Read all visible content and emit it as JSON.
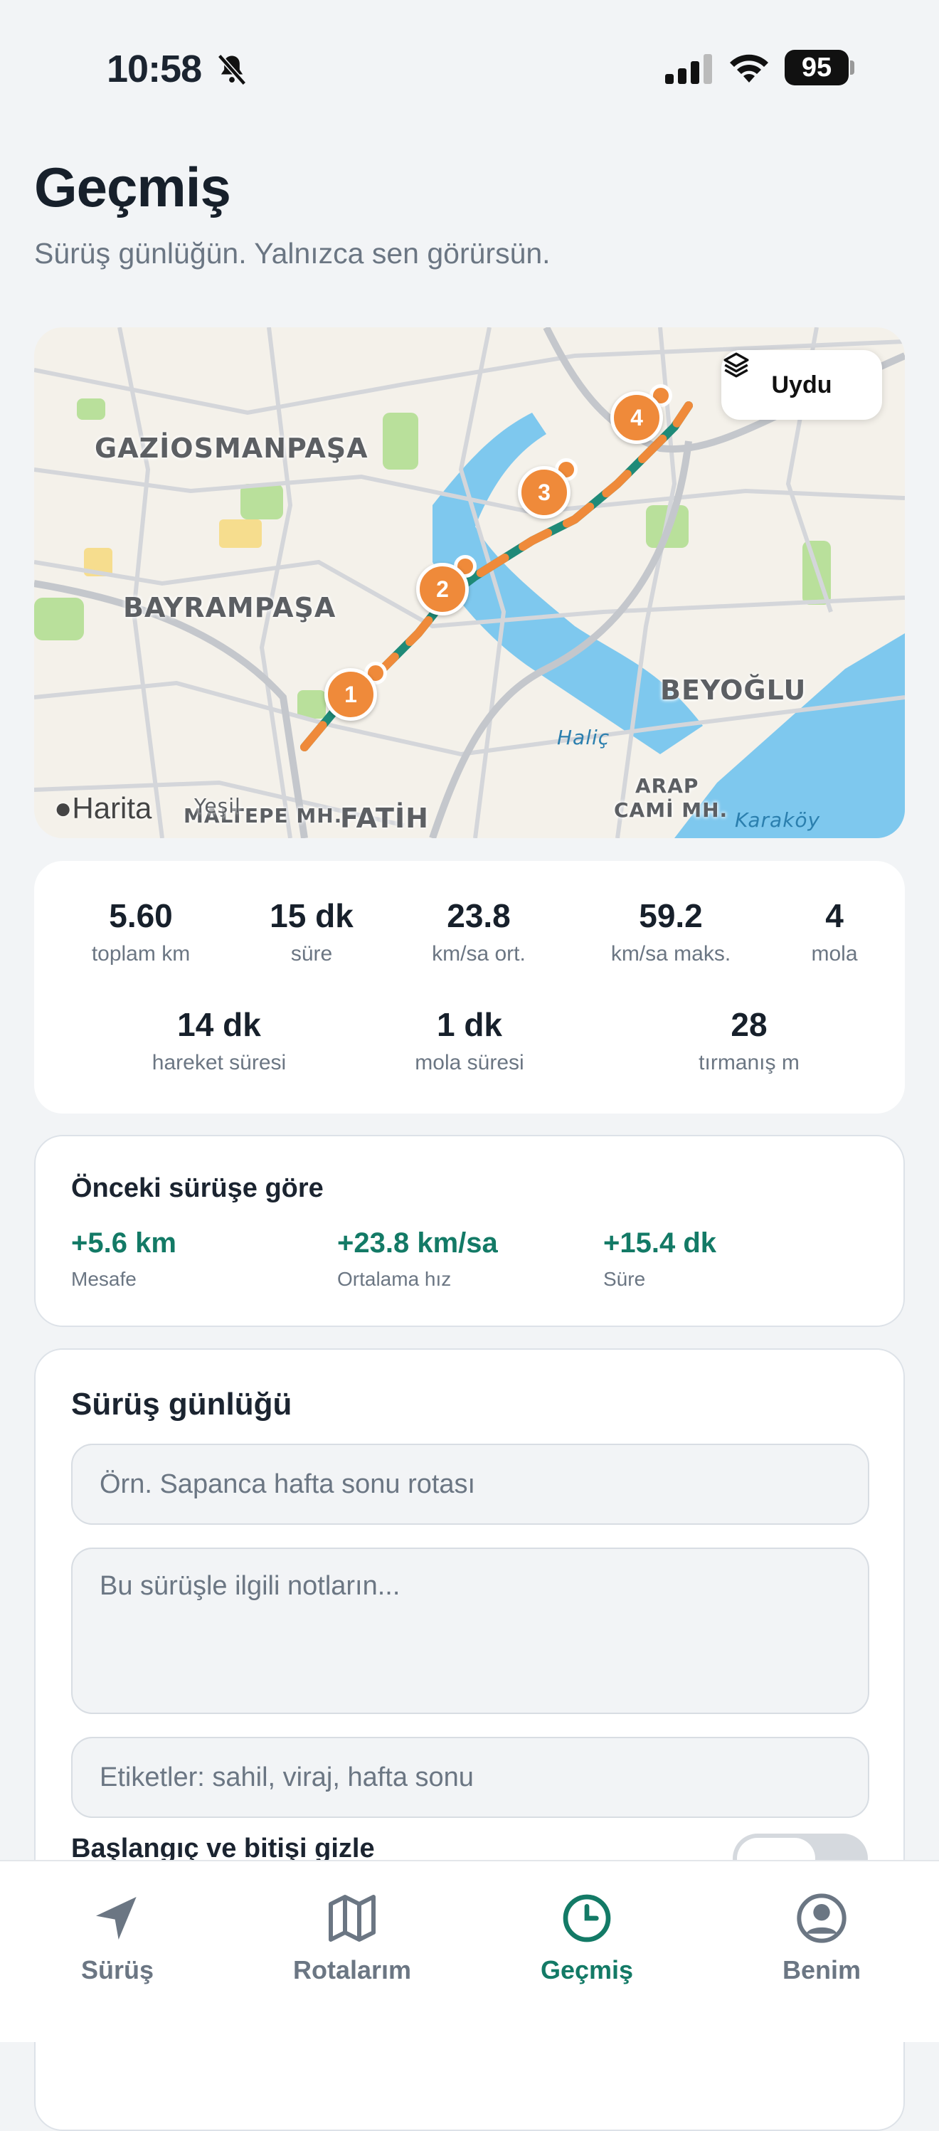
{
  "status_bar": {
    "time": "10:58",
    "battery": "95"
  },
  "page": {
    "title": "Geçmiş",
    "subtitle": "Sürüş günlüğün. Yalnızca sen görürsün."
  },
  "map": {
    "satellite_button": "Uydu",
    "brand": "Harita",
    "labels": {
      "gaziosmanpasa": "GAZİOSMANPAŞA",
      "bayrampasa": "BAYRAMPAŞA",
      "beyoglu": "BEYOĞLU",
      "halic": "Haliç",
      "arap": "ARAP",
      "cami": "CAMİ MH.",
      "fatih": "FATİH",
      "maltepe": "MALTEPE MH.",
      "yesil": "Yeşil",
      "karakoy": "Karaköy"
    },
    "stops": [
      "1",
      "2",
      "3",
      "4"
    ]
  },
  "stats": {
    "distance": {
      "value": "5.60",
      "label": "toplam km"
    },
    "duration": {
      "value": "15 dk",
      "label": "süre"
    },
    "avg_speed": {
      "value": "23.8",
      "label": "km/sa ort."
    },
    "max_speed": {
      "value": "59.2",
      "label": "km/sa maks."
    },
    "breaks": {
      "value": "4",
      "label": "mola"
    },
    "moving_time": {
      "value": "14 dk",
      "label": "hareket süresi"
    },
    "break_time": {
      "value": "1 dk",
      "label": "mola süresi"
    },
    "climb": {
      "value": "28",
      "label": "tırmanış m"
    }
  },
  "comparison": {
    "title": "Önceki sürüşe göre",
    "items": [
      {
        "value": "+5.6 km",
        "label": "Mesafe"
      },
      {
        "value": "+23.8 km/sa",
        "label": "Ortalama hız"
      },
      {
        "value": "+15.4 dk",
        "label": "Süre"
      }
    ]
  },
  "journal": {
    "title": "Sürüş günlüğü",
    "name_placeholder": "Örn. Sapanca hafta sonu rotası",
    "notes_placeholder": "Bu sürüşle ilgili notların...",
    "tags_placeholder": "Etiketler: sahil, viraj, hafta sonu",
    "hide_label": "Başlangıç ve bitişi gizle"
  },
  "tabs": [
    "Sürüş",
    "Rotalarım",
    "Geçmiş",
    "Benim"
  ],
  "colors": {
    "accent": "#137a66",
    "route": "#ef8a3a",
    "water": "#7ec8ee"
  }
}
